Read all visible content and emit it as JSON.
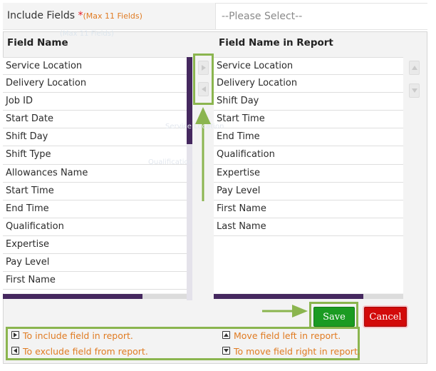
{
  "header": {
    "label": "Include Fields ",
    "required_mark": "*",
    "max_note": "(Max 11 Fields)",
    "select_placeholder": "--Please Select--"
  },
  "left_list": {
    "title": "Field Name",
    "items": [
      "Service Location",
      "Delivery Location",
      "Job ID",
      "Start Date",
      "Shift Day",
      "Shift Type",
      "Allowances Name",
      "Start Time",
      "End Time",
      "Qualification",
      "Expertise",
      "Pay Level",
      "First Name"
    ]
  },
  "right_list": {
    "title": "Field Name in Report",
    "items": [
      "Service Location",
      "Delivery Location",
      "Shift Day",
      "Start Time",
      "End Time",
      "Qualification",
      "Expertise",
      "Pay Level",
      "First Name",
      "Last Name"
    ]
  },
  "icons": {
    "include": "arrow-right-icon",
    "exclude": "arrow-left-icon",
    "move_up": "arrow-up-icon",
    "move_down": "arrow-down-icon"
  },
  "buttons": {
    "save": "Save",
    "cancel": "Cancel"
  },
  "help": {
    "include": "To include field in report.",
    "exclude": "To exclude field from report.",
    "move_left": "Move field left in report.",
    "move_right": "To move field right in report."
  },
  "colors": {
    "accent": "#45285f",
    "save": "#1b9b22",
    "cancel": "#d20a0a",
    "note": "#e07b22",
    "callout": "#8bb54f"
  }
}
